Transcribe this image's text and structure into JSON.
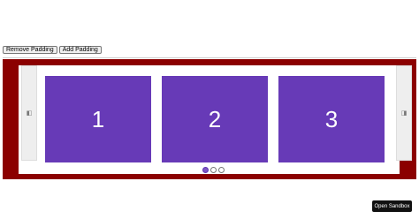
{
  "toolbar": {
    "remove_padding_label": "Remove Padding",
    "add_padding_label": "Add Padding"
  },
  "carousel": {
    "prev_icon": "◧",
    "next_icon": "◨",
    "slides": [
      {
        "label": "1"
      },
      {
        "label": "2"
      },
      {
        "label": "3"
      }
    ],
    "active_dot": 1,
    "dot_count": 3
  },
  "colors": {
    "frame": "#8b0000",
    "slide": "#673ab7",
    "dot_active": "#7e57c2"
  },
  "sandbox": {
    "label": "Open Sandbox"
  }
}
